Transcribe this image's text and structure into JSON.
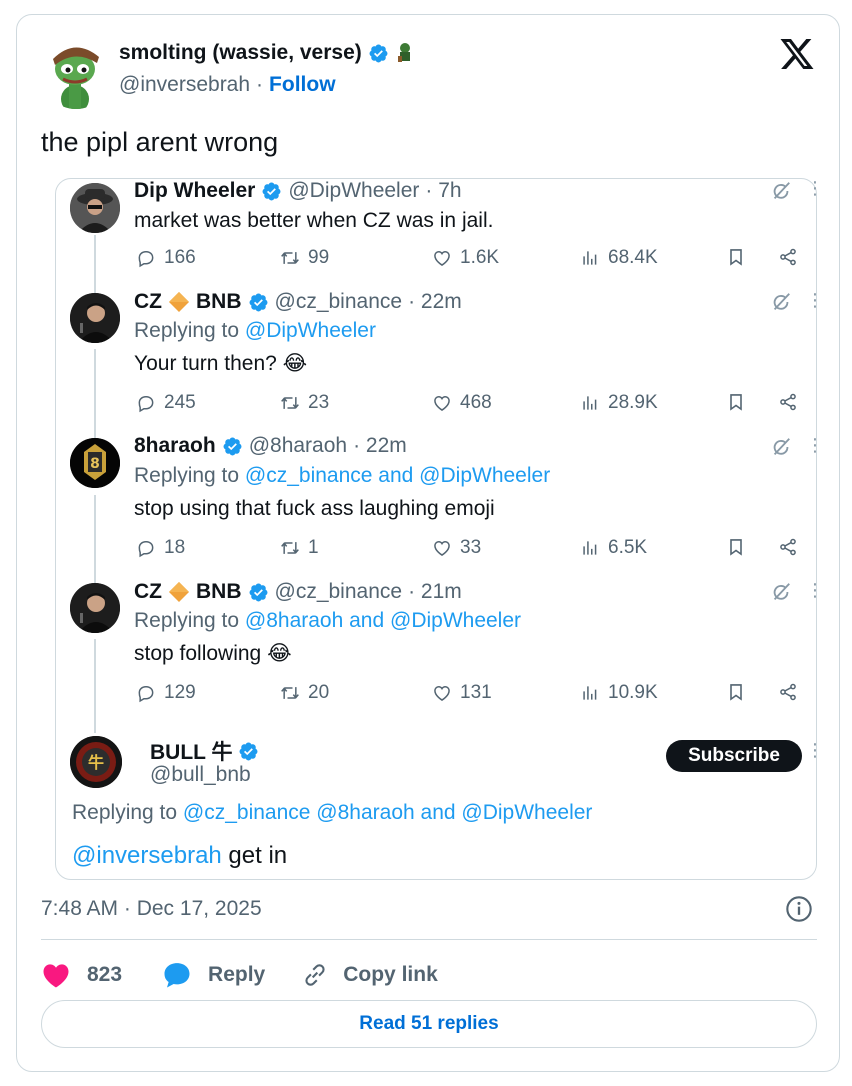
{
  "tweet": {
    "author_name": "smolting (wassie, verse)",
    "author_handle": "@inversebrah",
    "separator": "·",
    "follow_label": "Follow",
    "text": "the pipl arent wrong",
    "timestamp": "7:48 AM · Dec 17, 2025",
    "likes": "823",
    "reply_label": "Reply",
    "copy_link_label": "Copy link",
    "read_replies_label": "Read 51 replies"
  },
  "thread": [
    {
      "name": "Dip Wheeler",
      "handle": "@DipWheeler",
      "time": "· 7h",
      "replying_prefix": "",
      "replying_to": "",
      "text": "market was better when CZ was in jail.",
      "replies": "166",
      "retweets": "99",
      "likes": "1.6K",
      "views": "68.4K"
    },
    {
      "name": "CZ",
      "name_suffix": "BNB",
      "handle": "@cz_binance",
      "time": "· 22m",
      "replying_prefix": "Replying to",
      "replying_to": "@DipWheeler",
      "text": "Your turn then? 😂",
      "replies": "245",
      "retweets": "23",
      "likes": "468",
      "views": "28.9K"
    },
    {
      "name": "8haraoh",
      "handle": "@8haraoh",
      "time": "· 22m",
      "replying_prefix": "Replying to",
      "replying_to": "@cz_binance and @DipWheeler",
      "text": "stop using that fuck ass laughing emoji",
      "replies": "18",
      "retweets": "1",
      "likes": "33",
      "views": "6.5K"
    },
    {
      "name": "CZ",
      "name_suffix": "BNB",
      "handle": "@cz_binance",
      "time": "· 21m",
      "replying_prefix": "Replying to",
      "replying_to": "@8haraoh and @DipWheeler",
      "text": "stop following 😂",
      "replies": "129",
      "retweets": "20",
      "likes": "131",
      "views": "10.9K"
    }
  ],
  "final_reply": {
    "name": "BULL 牛",
    "handle": "@bull_bnb",
    "subscribe_label": "Subscribe",
    "replying_prefix": "Replying to",
    "replying_to": "@cz_binance @8haraoh and @DipWheeler",
    "mention": "@inversebrah",
    "text": " get in"
  },
  "colors": {
    "verified": "#1d9bf0",
    "link": "#1d9bf0",
    "like_heart": "#f91880",
    "reply_bubble": "#1d9bf0",
    "bnb_diamond": "#f0a23b"
  },
  "icons": [
    "x-logo-icon",
    "verified-badge-icon",
    "reply-icon",
    "retweet-icon",
    "like-icon",
    "views-icon",
    "bookmark-icon",
    "share-icon",
    "grok-icon",
    "more-icon",
    "info-icon",
    "heart-icon",
    "chat-bubble-icon",
    "link-icon"
  ]
}
